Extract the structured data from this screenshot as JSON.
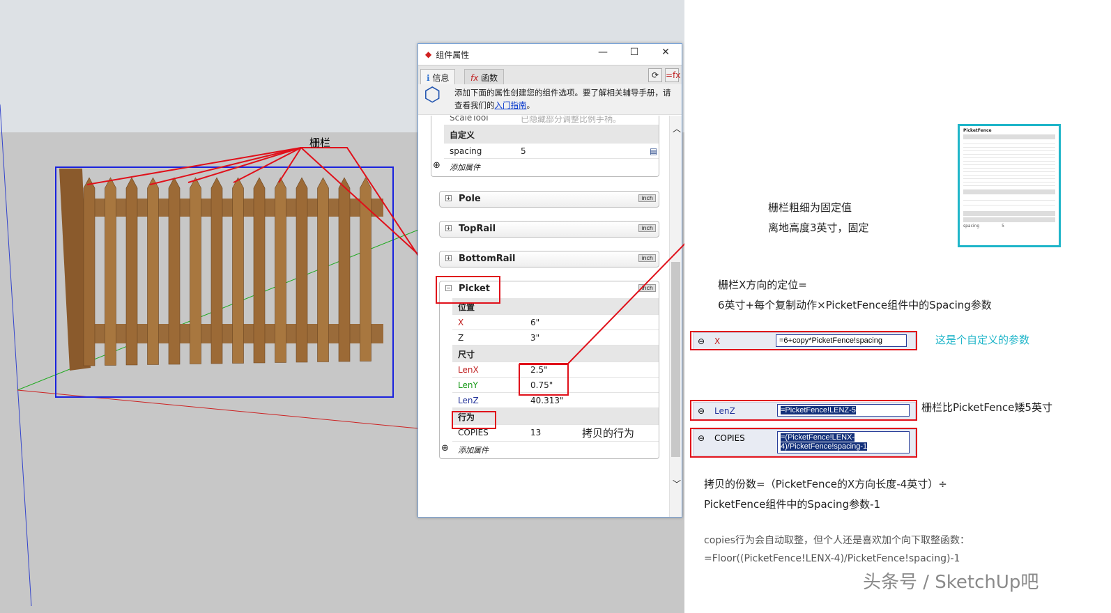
{
  "viewport": {
    "fence_label": "栅栏"
  },
  "dialog": {
    "title": "组件属性",
    "window_buttons": {
      "minimize": "—",
      "maximize": "☐",
      "close": "✕"
    },
    "tabs": [
      {
        "label": "信息"
      },
      {
        "label": "函数"
      }
    ],
    "info_text": "添加下面的属性创建您的组件选项。要了解相关辅导手册，请查看我们的",
    "info_link": "入门指南",
    "info_end": "。",
    "scaletool": {
      "key": "ScaleTool",
      "value": "已隐藏部分调整比例手柄。"
    },
    "custom": {
      "header": "自定义",
      "key": "spacing",
      "value": "5",
      "add": "添加属件"
    },
    "groups": [
      {
        "name": "Pole",
        "unit": "inch"
      },
      {
        "name": "TopRail",
        "unit": "inch"
      },
      {
        "name": "BottomRail",
        "unit": "inch"
      },
      {
        "name": "Picket",
        "unit": "inch"
      }
    ],
    "picket": {
      "position_header": "位置",
      "x": {
        "key": "X",
        "value": "6\""
      },
      "z": {
        "key": "Z",
        "value": "3\""
      },
      "size_header": "尺寸",
      "lenx": {
        "key": "LenX",
        "value": "2.5\""
      },
      "leny": {
        "key": "LenY",
        "value": "0.75\""
      },
      "lenz": {
        "key": "LenZ",
        "value": "40.313\""
      },
      "behavior_header": "行为",
      "copies": {
        "key": "COPIES",
        "value": "13"
      },
      "copies_note": "拷贝的行为",
      "add": "添加属件"
    }
  },
  "notes": {
    "fixed1": "栅栏粗细为固定值",
    "fixed2": "离地高度3英寸，固定",
    "xpos1": "栅栏X方向的定位=",
    "xpos2": "6英寸+每个复制动作×PicketFence组件中的Spacing参数",
    "custom_param": "这是个自定义的参数",
    "lenz_note": "栅栏比PicketFence矮5英寸",
    "copies1": "拷贝的份数=（PicketFence的X方向长度-4英寸）÷",
    "copies2": "PicketFence组件中的Spacing参数-1",
    "floor1": "copies行为会自动取整，但个人还是喜欢加个向下取整函数：",
    "floor2": "=Floor((PicketFence!LENX-4)/PicketFence!spacing)-1",
    "watermark": "头条号 / SketchUp吧"
  },
  "formulas": {
    "x": {
      "key": "X",
      "value": "=6+copy*PicketFence!spacing"
    },
    "lenz": {
      "key": "LenZ",
      "value": "=PicketFence!LENZ-5"
    },
    "copies": {
      "key": "COPIES",
      "value1": "=(PicketFence!LENX-",
      "value2": "4)/PicketFence!spacing-1"
    }
  },
  "thumbnail": {
    "title": "PicketFence",
    "spacing_key": "spacing",
    "spacing_value": "5"
  },
  "colors": {
    "accent_red": "#e0101a",
    "cyan": "#1fb5c9",
    "selection": "#13307a"
  }
}
